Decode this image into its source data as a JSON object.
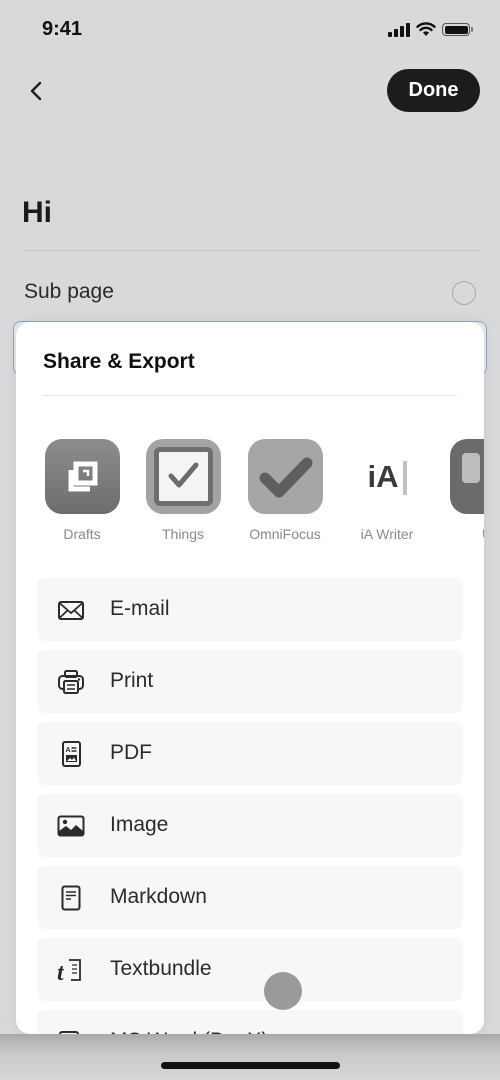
{
  "status_bar": {
    "time": "9:41"
  },
  "nav": {
    "back_icon": "chevron-left-icon",
    "done_label": "Done"
  },
  "page": {
    "title": "Hi",
    "subpage": {
      "label": "Sub page"
    }
  },
  "sheet": {
    "title": "Share & Export",
    "apps": [
      {
        "label": "Drafts",
        "icon": "drafts-app-icon"
      },
      {
        "label": "Things",
        "icon": "things-app-icon"
      },
      {
        "label": "OmniFocus",
        "icon": "omnifocus-app-icon"
      },
      {
        "label": "iA Writer",
        "icon": "ia-writer-app-icon",
        "glyph": "iA"
      },
      {
        "label": "U",
        "icon": "ulysses-app-icon"
      }
    ],
    "export_items": [
      {
        "label": "E-mail",
        "icon": "envelope-icon"
      },
      {
        "label": "Print",
        "icon": "printer-icon"
      },
      {
        "label": "PDF",
        "icon": "pdf-document-icon"
      },
      {
        "label": "Image",
        "icon": "image-icon"
      },
      {
        "label": "Markdown",
        "icon": "markdown-document-icon"
      },
      {
        "label": "Textbundle",
        "icon": "textbundle-icon"
      },
      {
        "label": "MS Word (DocX)",
        "icon": "word-document-icon"
      }
    ]
  }
}
